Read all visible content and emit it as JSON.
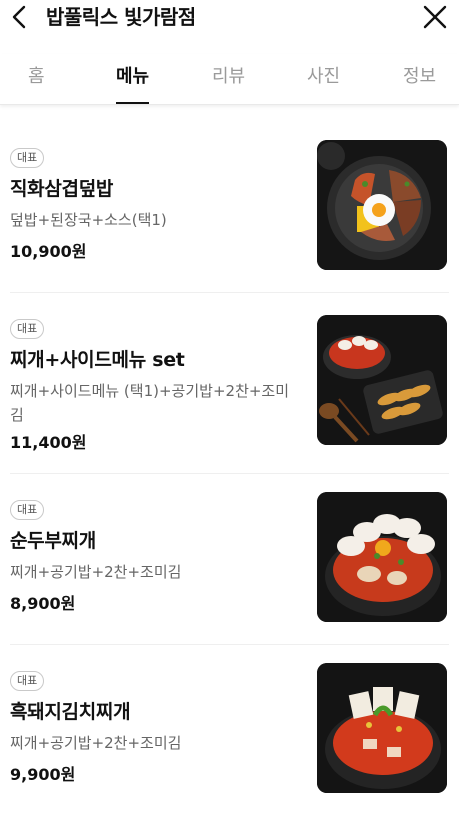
{
  "header": {
    "title": "밥풀릭스 빛가람점"
  },
  "tabs": [
    {
      "label": "홈",
      "active": false
    },
    {
      "label": "메뉴",
      "active": true
    },
    {
      "label": "리뷰",
      "active": false
    },
    {
      "label": "사진",
      "active": false
    },
    {
      "label": "정보",
      "active": false
    }
  ],
  "menu": [
    {
      "badge": "대표",
      "name": "직화삼겹덮밥",
      "desc": "덮밥+된장국+소스(택1)",
      "price": "10,900원",
      "image_icon": "pork-rice-bowl"
    },
    {
      "badge": "대표",
      "name": "찌개+사이드메뉴 set",
      "desc": "찌개+사이드메뉴 (택1)+공기밥+2찬+조미김",
      "price": "11,400원",
      "image_icon": "stew-side-set"
    },
    {
      "badge": "대표",
      "name": "순두부찌개",
      "desc": "찌개+공기밥+2찬+조미김",
      "price": "8,900원",
      "image_icon": "soft-tofu-stew"
    },
    {
      "badge": "대표",
      "name": "흑돼지김치찌개",
      "desc": "찌개+공기밥+2찬+조미김",
      "price": "9,900원",
      "image_icon": "kimchi-stew"
    }
  ]
}
